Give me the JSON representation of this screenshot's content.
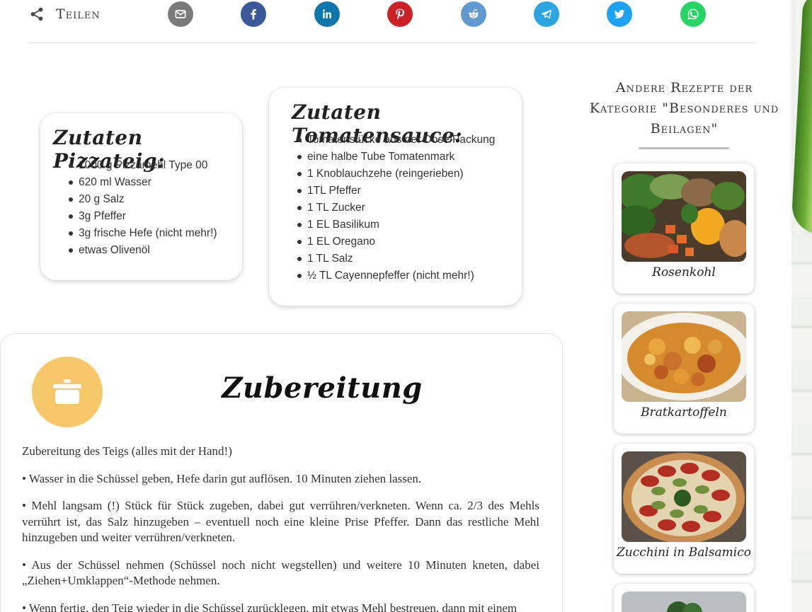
{
  "share": {
    "label": "Teilen",
    "icons": [
      {
        "name": "email-icon",
        "color": "#7a7a7a"
      },
      {
        "name": "facebook-icon",
        "color": "#3b5998"
      },
      {
        "name": "linkedin-icon",
        "color": "#0e76a8"
      },
      {
        "name": "pinterest-icon",
        "color": "#cb2027"
      },
      {
        "name": "reddit-icon",
        "color": "#5f99cf"
      },
      {
        "name": "telegram-icon",
        "color": "#2ca5e0"
      },
      {
        "name": "twitter-icon",
        "color": "#1da1f2"
      },
      {
        "name": "whatsapp-icon",
        "color": "#25d366"
      }
    ]
  },
  "dough": {
    "title": "Zutaten Pizzateig:",
    "items": [
      "1000 g Pizzamehl Type 00",
      "620 ml Wasser",
      "20 g Salz",
      "3g Pfeffer",
      "3g frische Hefe (nicht mehr!)",
      "etwas Olivenöl"
    ]
  },
  "sauce": {
    "title": "Zutaten Tomatensauce:",
    "items": [
      "Tomatenstücke aus der Dose/Packung",
      "eine halbe Tube Tomatenmark",
      "1 Knoblauchzehe (reingerieben)",
      "1TL Pfeffer",
      "1 TL Zucker",
      "1 EL Basilikum",
      "1 EL Oregano",
      "1 TL Salz",
      "½ TL Cayennepfeffer (nicht mehr!)"
    ]
  },
  "sidebar": {
    "title": "Andere Rezepte der Kategorie \"Besonderes und Beilagen\"",
    "recipes": [
      {
        "name": "Rosenkohl"
      },
      {
        "name": "Bratkartoffeln"
      },
      {
        "name": "Zucchini in Balsamico"
      },
      {
        "name": ""
      }
    ]
  },
  "prep": {
    "title": "Zubereitung",
    "icon": "pot-icon",
    "accent": "#f7c86a",
    "paragraphs": [
      "Zubereitung des Teigs (alles mit der Hand!)",
      "• Wasser in die Schüssel geben, Hefe darin gut auflösen. 10 Minuten ziehen lassen.",
      "• Mehl langsam (!) Stück für Stück zugeben, dabei gut verrühren/verkneten. Wenn ca. 2/3 des Mehls verrührt ist, das Salz hinzugeben – eventuell noch eine kleine Prise Pfeffer. Dann das restliche Mehl hinzugeben und weiter verrühren/verkneten.",
      "• Aus der Schüssel nehmen (Schüssel noch nicht wegstellen) und weitere 10 Minuten kneten, dabei „Ziehen+Umklappen“-Methode nehmen.",
      "• Wenn fertig, den Teig wieder in die Schüssel zurücklegen, mit etwas Mehl bestreuen, dann mit einem"
    ]
  }
}
